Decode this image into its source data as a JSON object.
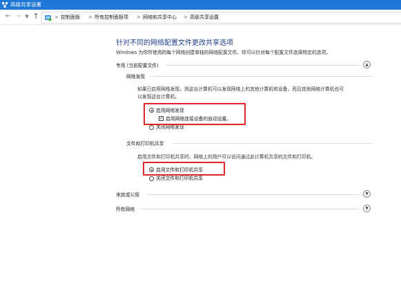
{
  "window": {
    "title": "高级共享设置"
  },
  "address_bar": {
    "breadcrumbs": [
      "控制面板",
      "所有控制面板项",
      "网络和共享中心",
      "高级共享设置"
    ],
    "separator": ">"
  },
  "icons": {
    "back": "back-arrow-icon",
    "forward": "forward-arrow-icon",
    "recent": "chevron-down-icon",
    "up": "up-arrow-icon",
    "breadcrumb": "control-panel-icon",
    "collapse": "chevron-up-icon",
    "expand": "chevron-down-icon"
  },
  "main": {
    "heading": "针对不同的网络配置文件更改共享选项",
    "description": "Windows 为你所使用的每个网络创建单独的网络配置文件。你可以针对每个配置文件选择特定的选项。",
    "profiles": [
      {
        "label": "专用 (当前配置文件)",
        "expanded": true
      },
      {
        "label": "来宾或公用",
        "expanded": false
      },
      {
        "label": "所有网络",
        "expanded": false
      }
    ],
    "network_discovery": {
      "title": "网络发现",
      "description": "如果已启用网络发现，则这台计算机可以发现网络上的其他计算机和设备，而且其他网络计算机也可以发现这台计算机。",
      "options": [
        {
          "label": "启用网络发现",
          "selected": true
        },
        {
          "label": "关闭网络发现",
          "selected": false
        }
      ],
      "auto_setup": {
        "label": "启用网络连接设备的自动设置。",
        "checked": true
      }
    },
    "file_printer_sharing": {
      "title": "文件和打印机共享",
      "description": "启用文件和打印机共享时，网络上的用户可以访问通过此计算机共享的文件和打印机。",
      "options": [
        {
          "label": "启用文件和打印机共享",
          "selected": true
        },
        {
          "label": "关闭文件和打印机共享",
          "selected": false
        }
      ]
    }
  },
  "colors": {
    "titlebar": "#1e78d7",
    "heading": "#1e3d8a",
    "highlight": "#e0242a"
  }
}
